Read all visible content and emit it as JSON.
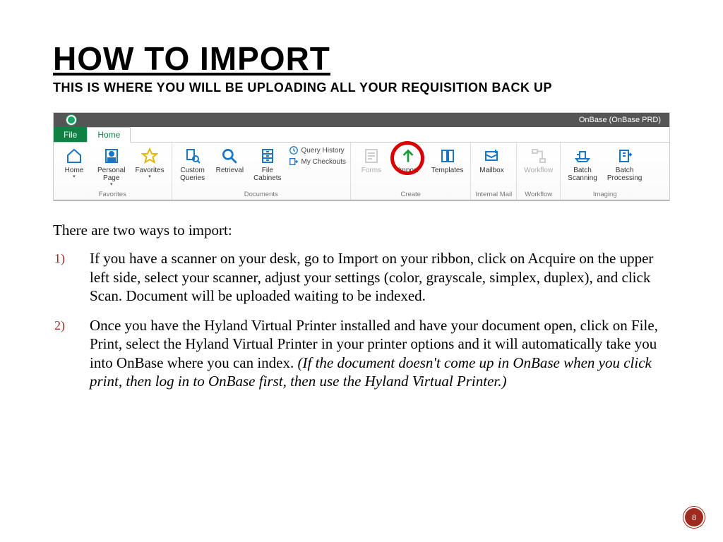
{
  "slide": {
    "title": "HOW TO IMPORT",
    "subtitle": "THIS IS WHERE YOU WILL BE UPLOADING ALL YOUR REQUISITION BACK UP",
    "page_number": "8"
  },
  "app": {
    "window_title": "OnBase (OnBase PRD)",
    "tabs": {
      "file": "File",
      "home": "Home"
    }
  },
  "ribbon": {
    "groups": {
      "favorites": {
        "label": "Favorites",
        "home": "Home",
        "personal_page": "Personal\nPage",
        "favorites": "Favorites"
      },
      "documents": {
        "label": "Documents",
        "custom_queries": "Custom\nQueries",
        "retrieval": "Retrieval",
        "file_cabinets": "File\nCabinets",
        "query_history": "Query History",
        "my_checkouts": "My Checkouts"
      },
      "create": {
        "label": "Create",
        "forms": "Forms",
        "import": "Import",
        "templates": "Templates"
      },
      "internal_mail": {
        "label": "Internal Mail",
        "mailbox": "Mailbox"
      },
      "workflow": {
        "label": "Workflow",
        "workflow": "Workflow"
      },
      "imaging": {
        "label": "Imaging",
        "batch_scanning": "Batch\nScanning",
        "batch_processing": "Batch\nProcessing"
      }
    }
  },
  "body": {
    "intro": "There are two ways to import:",
    "step1": "If you have a scanner on your desk, go to Import on your ribbon, click on Acquire on the upper left side, select your scanner, adjust your settings (color, grayscale, simplex, duplex), and click Scan.  Document will be uploaded waiting to be indexed.",
    "step2_main": "Once you have the Hyland Virtual Printer installed and have your document open, click on File, Print, select the Hyland Virtual Printer in your printer options and it will automatically take you into OnBase where you can index. ",
    "step2_note": "(If the document doesn't come up in OnBase when you click print, then log in to OnBase first, then use the Hyland Virtual Printer.)"
  }
}
